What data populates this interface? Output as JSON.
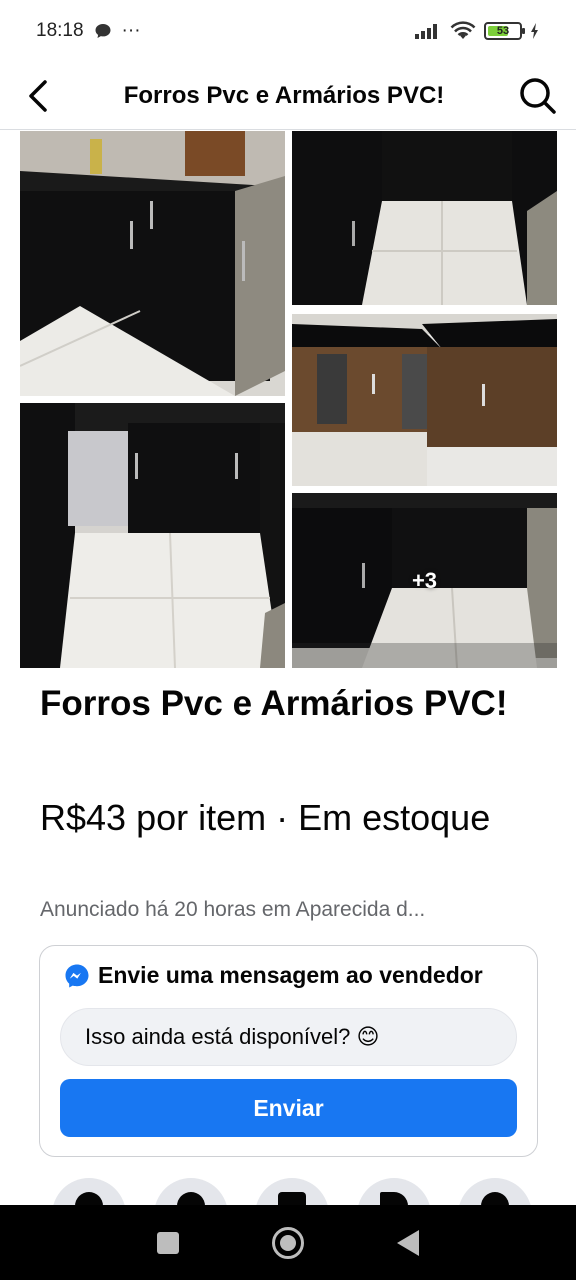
{
  "status_bar": {
    "time": "18:18",
    "more": "···",
    "battery": "53",
    "icons": [
      "chat-bubble-icon",
      "signal-icon",
      "wifi-icon",
      "battery-icon",
      "charging-icon"
    ]
  },
  "header": {
    "title": "Forros Pvc e Armários PVC!",
    "back_icon": "chevron-left-icon",
    "search_icon": "search-icon"
  },
  "photos": {
    "more_count": "+3"
  },
  "listing": {
    "title": "Forros Pvc e Armários PVC!",
    "price": "R$43 por item · Em estoque",
    "meta": "Anunciado há 20 horas em Aparecida d..."
  },
  "message_card": {
    "heading": "Envie uma mensagem ao vendedor",
    "input_value": "Isso ainda está disponível? 😊",
    "send_label": "Enviar",
    "icon": "messenger-icon"
  },
  "colors": {
    "accent": "#1877f2",
    "text": "#050505",
    "secondary_text": "#65676b"
  }
}
